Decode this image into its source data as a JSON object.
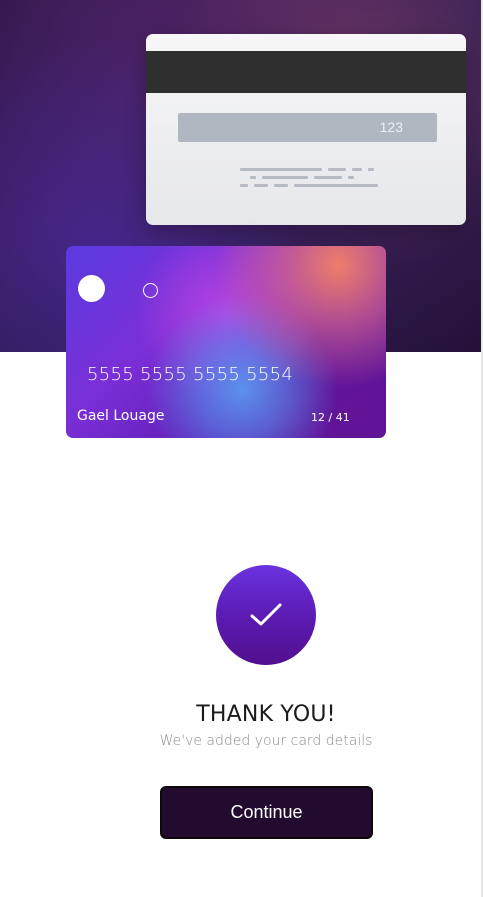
{
  "card_back": {
    "cvv": "123"
  },
  "card_front": {
    "number": "5555 5555 5555 5554",
    "holder": "Gael Louage",
    "expiry": "12 / 41"
  },
  "confirmation": {
    "icon": "checkmark-icon",
    "title": "THANK YOU!",
    "subtitle": "We've added your card details"
  },
  "actions": {
    "continue_label": "Continue"
  },
  "colors": {
    "hero_background": "#2a1140",
    "button_background": "#230a2f",
    "check_circle": "#6a33e0",
    "signature_strip": "#b0b7c1",
    "magnetic_stripe": "#2f2f2f"
  }
}
